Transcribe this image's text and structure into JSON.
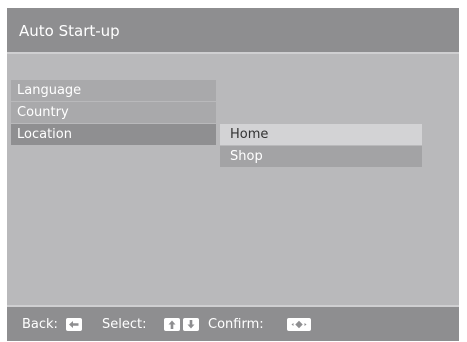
{
  "window": {
    "title": "Auto Start-up"
  },
  "menu": {
    "items": [
      {
        "label": "Language"
      },
      {
        "label": "Country"
      },
      {
        "label": "Location"
      }
    ]
  },
  "submenu": {
    "items": [
      {
        "label": "Home"
      },
      {
        "label": "Shop"
      }
    ]
  },
  "footer": {
    "back_label": "Back:",
    "select_label": "Select:",
    "confirm_label": "Confirm:",
    "back_icon": "left-arrow-icon",
    "select_icons": [
      "up-arrow-icon",
      "down-arrow-icon"
    ],
    "confirm_icon": "ok-diamond-icon"
  },
  "colors": {
    "panel_bg": "#b9b9bb",
    "header_bg": "#8e8e90",
    "selected_item_bg": "#8f8f91",
    "highlighted_option_bg": "#d3d3d5"
  }
}
